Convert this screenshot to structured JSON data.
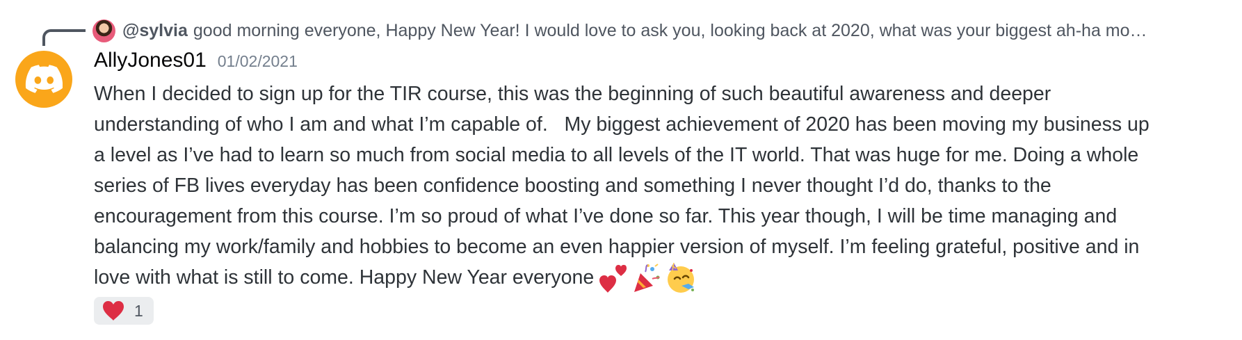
{
  "reply": {
    "author": "@sylvia",
    "text": "good morning everyone, Happy New Year! I would love to ask you, looking back at 2020, what was your biggest ah-ha mome..."
  },
  "message": {
    "author": "AllyJones01",
    "timestamp": "01/02/2021",
    "lines": [
      "When I decided to sign up for the TIR course, this was the beginning of such beautiful awareness and deeper",
      "understanding of who I am and what I’m capable of.   My biggest achievement of 2020 has been moving my business up",
      "a level as I’ve had to learn so much from social media to all levels of the IT world. That was huge for me. Doing a whole",
      "series of FB lives everyday has been confidence boosting and something I never thought I’d do, thanks to the",
      "encouragement from this course. I’m so proud of what I’ve done so far. This year though, I will be time managing and",
      "balancing my work/family and hobbies to become an even happier version of myself. I’m feeling grateful, positive and in",
      "love with what is still to come. Happy New Year everyone"
    ],
    "emojis": [
      "two-hearts-icon",
      "party-popper-icon",
      "partying-face-icon"
    ]
  },
  "reaction": {
    "emoji": "heart-icon",
    "count": "1"
  },
  "colors": {
    "avatar_bg": "#faa61a",
    "text": "#2e3338",
    "muted": "#747f8d",
    "heart": "#dd2e44",
    "reaction_bg": "#ebedef"
  }
}
